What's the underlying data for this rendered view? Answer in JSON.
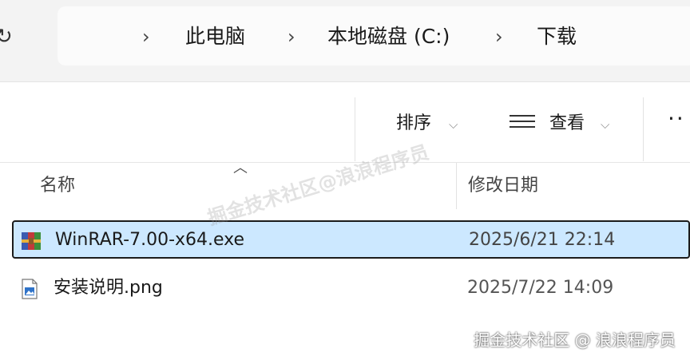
{
  "breadcrumb": {
    "items": [
      "此电脑",
      "本地磁盘 (C:)",
      "下载"
    ]
  },
  "toolbar": {
    "sort_label": "排序",
    "view_label": "查看",
    "more_label": "··"
  },
  "columns": {
    "name": "名称",
    "date_modified": "修改日期"
  },
  "files": [
    {
      "name": "WinRAR-7.00-x64.exe",
      "date": "2025/6/21 22:14",
      "icon": "winrar-icon",
      "selected": true
    },
    {
      "name": "安装说明.png",
      "date": "2025/7/22 14:09",
      "icon": "image-file-icon",
      "selected": false
    }
  ],
  "watermarks": {
    "center": "掘金技术社区@浪浪程序员",
    "corner": "掘金技术社区 @ 浪浪程序员"
  }
}
